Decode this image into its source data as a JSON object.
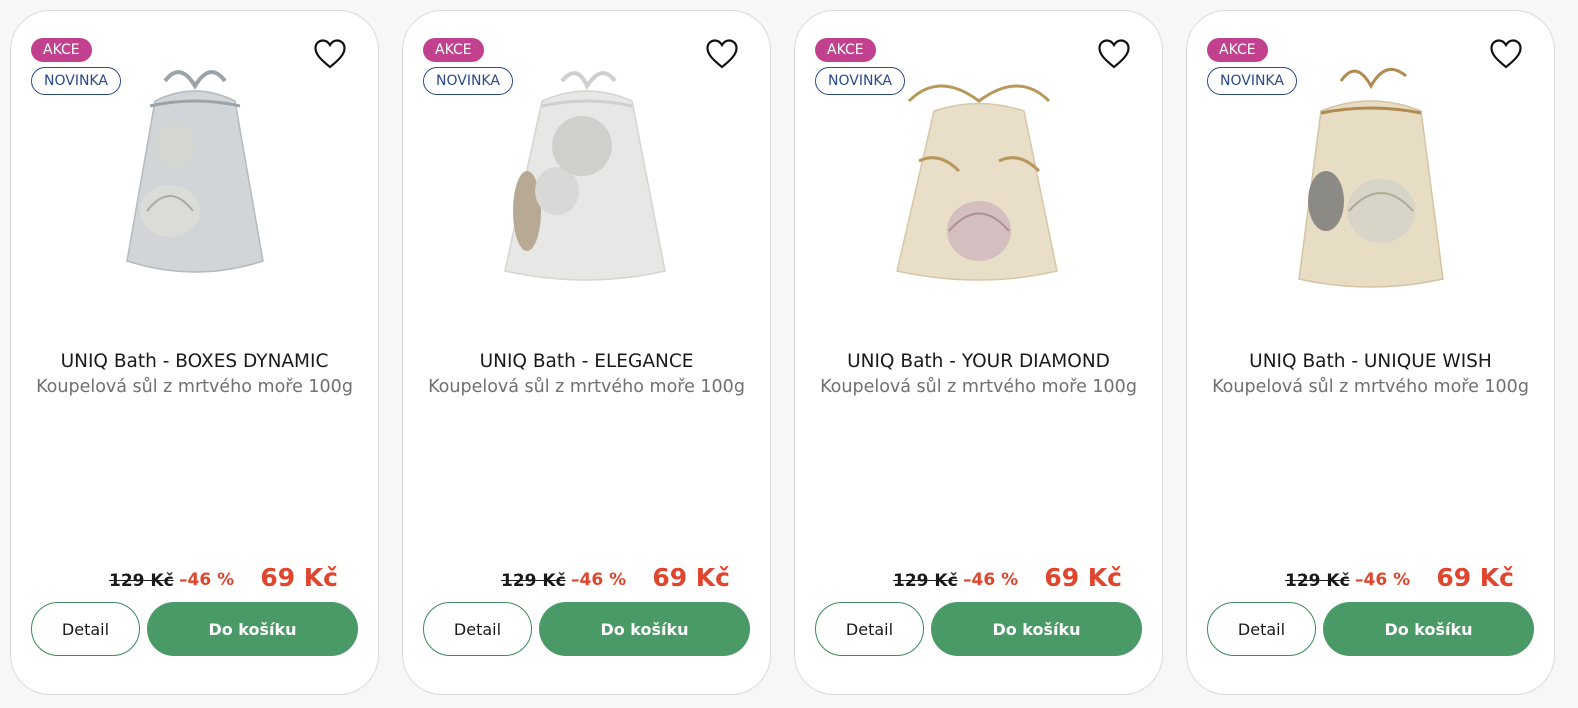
{
  "products": [
    {
      "badge_sale": "AKCE",
      "badge_new": "NOVINKA",
      "title": "UNIQ Bath - BOXES DYNAMIC",
      "subtitle": "Koupelová sůl z mrtvého moře 100g",
      "old_price": "129 Kč",
      "discount": "–46 %",
      "price": "69 Kč",
      "detail_label": "Detail",
      "cart_label": "Do košíku",
      "bag_color": "#c9ced0",
      "ribbon_color": "#9aa3a8"
    },
    {
      "badge_sale": "AKCE",
      "badge_new": "NOVINKA",
      "title": "UNIQ Bath - ELEGANCE",
      "subtitle": "Koupelová sůl z mrtvého moře 100g",
      "old_price": "129 Kč",
      "discount": "–46 %",
      "price": "69 Kč",
      "detail_label": "Detail",
      "cart_label": "Do košíku",
      "bag_color": "#e4e4e2",
      "ribbon_color": "#cfcfcf"
    },
    {
      "badge_sale": "AKCE",
      "badge_new": "NOVINKA",
      "title": "UNIQ Bath - YOUR DIAMOND",
      "subtitle": "Koupelová sůl z mrtvého moře 100g",
      "old_price": "129 Kč",
      "discount": "–46 %",
      "price": "69 Kč",
      "detail_label": "Detail",
      "cart_label": "Do košíku",
      "bag_color": "#e8dcc4",
      "ribbon_color": "#b8975a"
    },
    {
      "badge_sale": "AKCE",
      "badge_new": "NOVINKA",
      "title": "UNIQ Bath - UNIQUE WISH",
      "subtitle": "Koupelová sůl z mrtvého moře 100g",
      "old_price": "129 Kč",
      "discount": "–46 %",
      "price": "69 Kč",
      "detail_label": "Detail",
      "cart_label": "Do košíku",
      "bag_color": "#e6dbc2",
      "ribbon_color": "#b08a4e"
    }
  ],
  "colors": {
    "sale_badge": "#c2418f",
    "new_badge": "#2a4a8a",
    "price_red": "#e0452d",
    "cart_green": "#4a9a68"
  },
  "icons": {
    "favorite": "heart-outline-icon"
  }
}
